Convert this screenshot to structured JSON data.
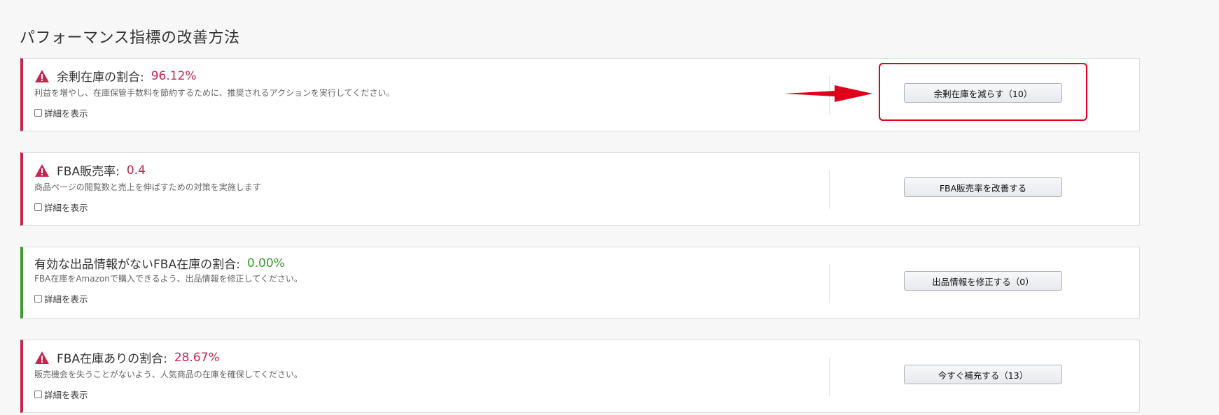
{
  "page": {
    "title": "パフォーマンス指標の改善方法"
  },
  "cards": [
    {
      "status": "warning",
      "title": "余剰在庫の割合:",
      "value": "96.12%",
      "description": "利益を増やし、在庫保管手数料を節約するために、推奨されるアクションを実行してください。",
      "detail_label": "詳細を表示",
      "button_label": "余剰在庫を減らす（10）"
    },
    {
      "status": "warning",
      "title": "FBA販売率:",
      "value": "0.4",
      "description": "商品ページの閲覧数と売上を伸ばすための対策を実施します",
      "detail_label": "詳細を表示",
      "button_label": "FBA販売率を改善する"
    },
    {
      "status": "ok",
      "title": "有効な出品情報がないFBA在庫の割合:",
      "value": "0.00%",
      "description": "FBA在庫をAmazonで購入できるよう、出品情報を修正してください。",
      "detail_label": "詳細を表示",
      "button_label": "出品情報を修正する（0）"
    },
    {
      "status": "warning",
      "title": "FBA在庫ありの割合:",
      "value": "28.67%",
      "description": "販売機会を失うことがないよう、人気商品の在庫を確保してください。",
      "detail_label": "詳細を表示",
      "button_label": "今すぐ補充する（13）"
    }
  ],
  "colors": {
    "warning": "#c7254e",
    "ok": "#3a9b2b",
    "annotation": "#e0001a"
  },
  "icons": {
    "warning": "warning-triangle-icon"
  }
}
